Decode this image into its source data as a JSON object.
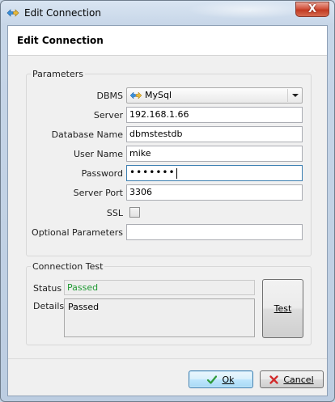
{
  "window": {
    "title": "Edit Connection",
    "close_label": "X"
  },
  "header": {
    "title": "Edit Connection"
  },
  "parameters": {
    "group_title": "Parameters",
    "dbms_label": "DBMS",
    "dbms_value": "MySql",
    "server_label": "Server",
    "server_value": "192.168.1.66",
    "database_label": "Database Name",
    "database_value": "dbmstestdb",
    "user_label": "User Name",
    "user_value": "mike",
    "password_label": "Password",
    "password_value": "•••••••",
    "port_label": "Server Port",
    "port_value": "3306",
    "ssl_label": "SSL",
    "ssl_checked": false,
    "optional_label": "Optional Parameters",
    "optional_value": ""
  },
  "connection_test": {
    "group_title": "Connection Test",
    "status_label": "Status",
    "status_value": "Passed",
    "details_label": "Details",
    "details_value": "Passed",
    "test_button": "Test",
    "status_color": "#1f9a33"
  },
  "footer": {
    "ok_label": "Ok",
    "cancel_label": "Cancel"
  },
  "icons": {
    "app": "plug-arrows-icon",
    "ok": "checkmark-icon",
    "cancel": "red-x-icon"
  }
}
